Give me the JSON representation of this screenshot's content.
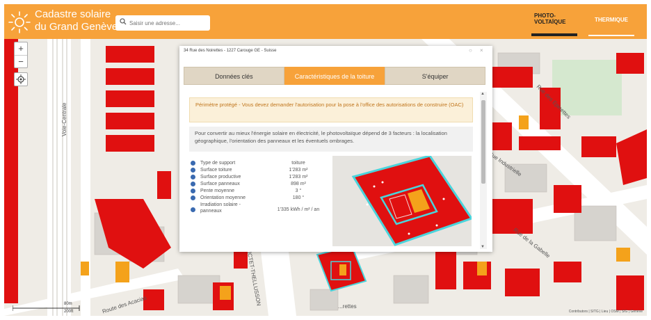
{
  "header": {
    "title_line1": "Cadastre solaire",
    "title_line2": "du Grand Genève",
    "search_placeholder": "Saisir une adresse...",
    "mode_pv": "PHOTO-\nVOLTAÏQUE",
    "mode_thermal": "THERMIQUE",
    "colors": {
      "header": "#f7a23a",
      "roof_high": "#e01010",
      "roof_mid": "#f4a21b"
    }
  },
  "map": {
    "streets": [
      "Voie-Centrale",
      "Rue des Epinettes",
      "Rue Industrielle",
      "Route des Acacias",
      "Rue de la Gabelle",
      "PICTET-THELLUSSON",
      "...rettes"
    ],
    "scale_top": "80m",
    "scale_bottom": "200ft",
    "attribution": "Contributors | SITG | Lieu | OSM | SIG | Genève"
  },
  "zoom": {
    "in": "+",
    "out": "−"
  },
  "popup": {
    "address": "34 Rue des Noirettes - 1227 Carouge GE - Suisse",
    "tabs": [
      {
        "label": "Données clés",
        "active": false
      },
      {
        "label": "Caractéristiques de la toiture",
        "active": true
      },
      {
        "label": "S'équiper",
        "active": false
      }
    ],
    "notice": "Périmètre protégé - Vous devez demander l'autorisation pour la pose à l'office des autorisations de construire (OAC)",
    "info": "Pour convertir au mieux l'énergie solaire en électricité, le photovoltaïque dépend de 3 facteurs : la localisation géographique, l'orientation des panneaux et les éventuels ombrages.",
    "stats": [
      {
        "label": "Type de support",
        "value": "toiture"
      },
      {
        "label": "Surface toiture",
        "value": "1'283 m²"
      },
      {
        "label": "Surface productive",
        "value": "1'283 m²"
      },
      {
        "label": "Surface panneaux",
        "value": "898 m²"
      },
      {
        "label": "Pente moyenne",
        "value": "3 °"
      },
      {
        "label": "Orientation moyenne",
        "value": "180 °"
      },
      {
        "label": "Irradiation solaire - panneaux",
        "value": "1'335 kWh / m² / an"
      }
    ]
  }
}
